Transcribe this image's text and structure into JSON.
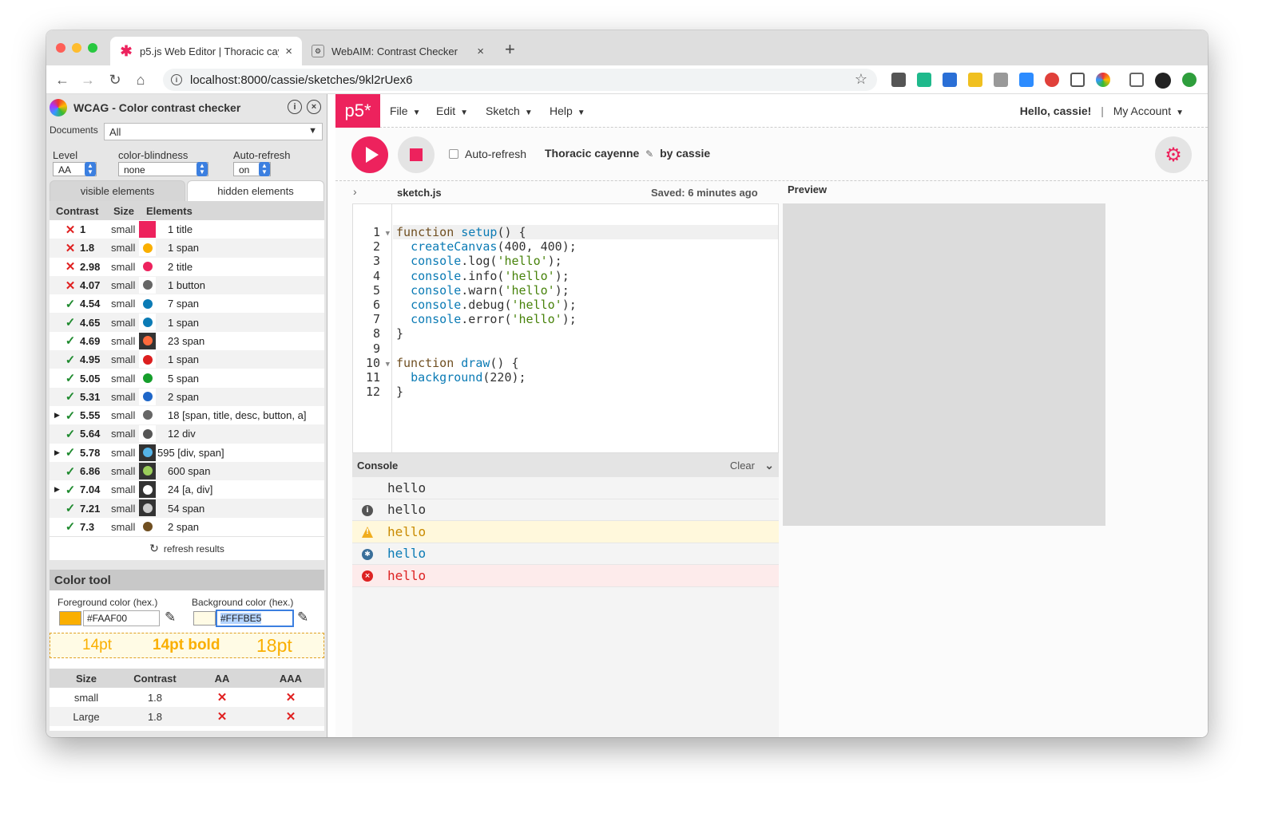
{
  "browser": {
    "tabs": [
      {
        "title": "p5.js Web Editor | Thoracic cay",
        "active": true
      },
      {
        "title": "WebAIM: Contrast Checker",
        "active": false
      }
    ],
    "url": "localhost:8000/cassie/sketches/9kl2rUex6"
  },
  "wcag": {
    "title": "WCAG - Color contrast checker",
    "documents_label": "Documents",
    "documents_value": "All",
    "level_label": "Level",
    "level_value": "AA",
    "colorblind_label": "color-blindness",
    "colorblind_value": "none",
    "autorefresh_label": "Auto-refresh",
    "autorefresh_value": "on",
    "tab_visible": "visible elements",
    "tab_hidden": "hidden elements",
    "headers": {
      "contrast": "Contrast",
      "size": "Size",
      "elements": "Elements"
    },
    "rows": [
      {
        "pass": false,
        "value": "1",
        "size": "small",
        "swatch": "#ed225d",
        "dot": "#ed225d",
        "elements": "1 title",
        "expand": false
      },
      {
        "pass": false,
        "value": "1.8",
        "size": "small",
        "swatch": "#ffffff",
        "dot": "#faaf00",
        "elements": "1 span",
        "expand": false
      },
      {
        "pass": false,
        "value": "2.98",
        "size": "small",
        "swatch": "#ffffff",
        "dot": "#ed225d",
        "elements": "2 title",
        "expand": false
      },
      {
        "pass": false,
        "value": "4.07",
        "size": "small",
        "swatch": "#ffffff",
        "dot": "#666666",
        "elements": "1 button",
        "expand": false
      },
      {
        "pass": true,
        "value": "4.54",
        "size": "small",
        "swatch": "#ffffff",
        "dot": "#0b7bb5",
        "elements": "7 span",
        "expand": false
      },
      {
        "pass": true,
        "value": "4.65",
        "size": "small",
        "swatch": "#ffffff",
        "dot": "#0b7bb5",
        "elements": "1 span",
        "expand": false
      },
      {
        "pass": true,
        "value": "4.69",
        "size": "small",
        "swatch": "#333333",
        "dot": "#ff6a3c",
        "elements": "23 span",
        "expand": false
      },
      {
        "pass": true,
        "value": "4.95",
        "size": "small",
        "swatch": "#ffffff",
        "dot": "#dc1f1f",
        "elements": "1 span",
        "expand": false
      },
      {
        "pass": true,
        "value": "5.05",
        "size": "small",
        "swatch": "#ffffff",
        "dot": "#159e2b",
        "elements": "5 span",
        "expand": false
      },
      {
        "pass": true,
        "value": "5.31",
        "size": "small",
        "swatch": "#ffffff",
        "dot": "#1e66c8",
        "elements": "2 span",
        "expand": false
      },
      {
        "pass": true,
        "value": "5.55",
        "size": "small",
        "swatch": "#ffffff",
        "dot": "#666666",
        "elements": "18 [span, title, desc, button, a]",
        "expand": true
      },
      {
        "pass": true,
        "value": "5.64",
        "size": "small",
        "swatch": "#ffffff",
        "dot": "#555555",
        "elements": "12 div",
        "expand": false
      },
      {
        "pass": true,
        "value": "5.78",
        "size": "small",
        "swatch": "#333333",
        "dot": "#55b4e8",
        "elements": "595 [div, span]",
        "expand": true
      },
      {
        "pass": true,
        "value": "6.86",
        "size": "small",
        "swatch": "#333333",
        "dot": "#9acd5a",
        "elements": "600 span",
        "expand": false
      },
      {
        "pass": true,
        "value": "7.04",
        "size": "small",
        "swatch": "#333333",
        "dot": "#ffffff",
        "elements": "24 [a, div]",
        "expand": true
      },
      {
        "pass": true,
        "value": "7.21",
        "size": "small",
        "swatch": "#333333",
        "dot": "#cccccc",
        "elements": "54 span",
        "expand": false
      },
      {
        "pass": true,
        "value": "7.3",
        "size": "small",
        "swatch": "#ffffff",
        "dot": "#704f21",
        "elements": "2 span",
        "expand": false
      }
    ],
    "refresh_label": "refresh results",
    "color_tool": {
      "title": "Color tool",
      "fg_label": "Foreground color (hex.)",
      "fg_value": "#FAAF00",
      "bg_label": "Background color (hex.)",
      "bg_value": "#FFFBE5",
      "preview": {
        "small": "14pt",
        "bold": "14pt bold",
        "large": "18pt"
      },
      "result_headers": {
        "size": "Size",
        "contrast": "Contrast",
        "aa": "AA",
        "aaa": "AAA"
      },
      "results": [
        {
          "size": "small",
          "contrast": "1.8",
          "aa": false,
          "aaa": false
        },
        {
          "size": "Large",
          "contrast": "1.8",
          "aa": false,
          "aaa": false
        }
      ]
    }
  },
  "p5": {
    "logo": "p5*",
    "menus": [
      "File",
      "Edit",
      "Sketch",
      "Help"
    ],
    "greeting": "Hello, cassie!",
    "account": "My Account",
    "autorefresh": "Auto-refresh",
    "sketch_name": "Thoracic cayenne",
    "by": "by cassie",
    "filename": "sketch.js",
    "saved": "Saved: 6 minutes ago",
    "preview_label": "Preview",
    "console_label": "Console",
    "clear_label": "Clear",
    "code": [
      {
        "n": "1",
        "fold": true
      },
      {
        "n": "2"
      },
      {
        "n": "3"
      },
      {
        "n": "4"
      },
      {
        "n": "5"
      },
      {
        "n": "6"
      },
      {
        "n": "7"
      },
      {
        "n": "8"
      },
      {
        "n": "9"
      },
      {
        "n": "10",
        "fold": true
      },
      {
        "n": "11"
      },
      {
        "n": "12"
      }
    ],
    "console": [
      {
        "type": "log",
        "text": "hello"
      },
      {
        "type": "info",
        "text": "hello"
      },
      {
        "type": "warn",
        "text": "hello"
      },
      {
        "type": "debug",
        "text": "hello"
      },
      {
        "type": "error",
        "text": "hello"
      }
    ]
  },
  "colors": {
    "accent": "#ed225d",
    "warn_bg": "#fff8dc",
    "error_bg": "#fdebeb"
  }
}
